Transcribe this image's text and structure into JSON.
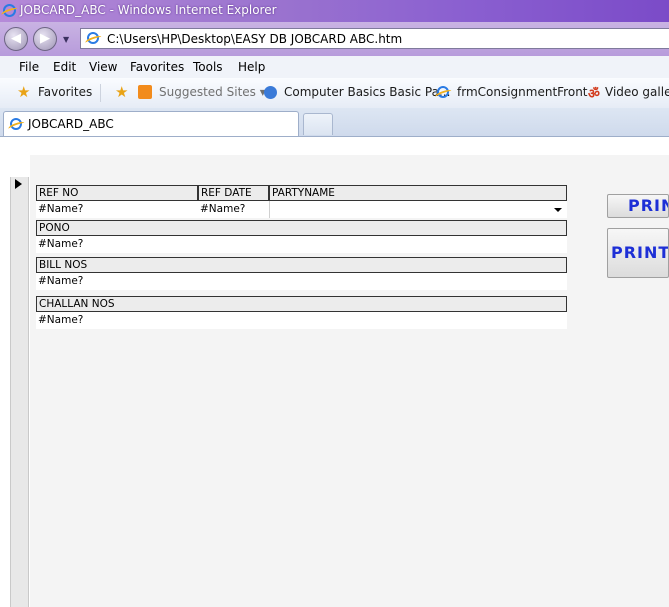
{
  "window": {
    "title": "JOBCARD_ABC - Windows Internet Explorer"
  },
  "address": {
    "url": "C:\\Users\\HP\\Desktop\\EASY DB JOBCARD ABC.htm"
  },
  "menu": [
    "File",
    "Edit",
    "View",
    "Favorites",
    "Tools",
    "Help"
  ],
  "favorites": {
    "label": "Favorites",
    "items": [
      "Suggested Sites ▾",
      "Computer Basics Basic Pa...",
      "frmConsignmentFront",
      "Video gallery"
    ]
  },
  "tab": {
    "title": "JOBCARD_ABC"
  },
  "form": {
    "ref_no_label": "REF NO",
    "ref_date_label": "REF DATE",
    "party_label": "PARTYNAME",
    "ref_no_value": "#Name?",
    "ref_date_value": "#Name?",
    "party_value": "",
    "pono_label": "PONO",
    "pono_value": "#Name?",
    "bill_label": "BILL NOS",
    "bill_value": "#Name?",
    "challan_label": "CHALLAN NOS",
    "challan_value": "#Name?"
  },
  "buttons": {
    "print1": "PRIN",
    "print2": "PRINT"
  }
}
